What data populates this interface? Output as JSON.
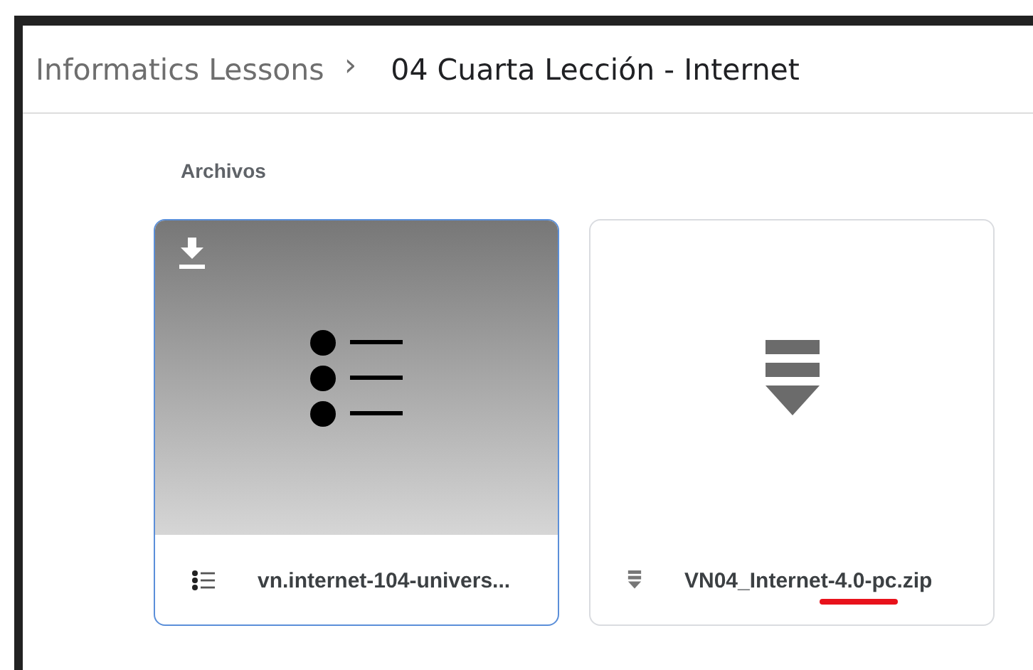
{
  "breadcrumb": {
    "parent": "Informatics Lessons",
    "separator": "›",
    "current": "04 Cuarta Lección - Internet"
  },
  "section": {
    "title": "Archivos"
  },
  "files": [
    {
      "name": "vn.internet-104-univers...",
      "kind": "list",
      "selected": true,
      "underlined": false
    },
    {
      "name": "VN04_Internet-4.0-pc.zip",
      "kind": "archive",
      "selected": false,
      "underlined": true
    }
  ]
}
